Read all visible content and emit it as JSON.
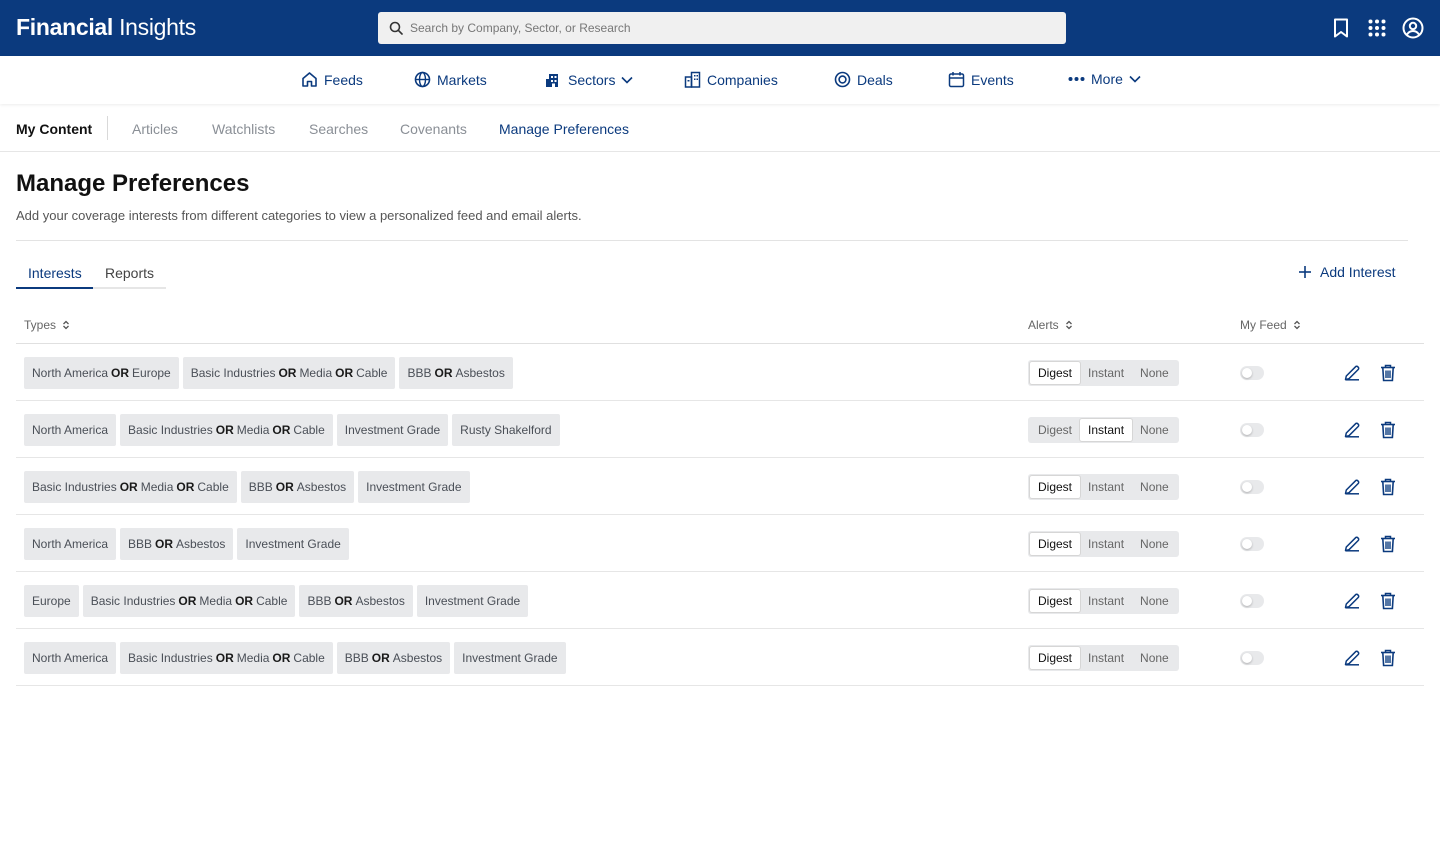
{
  "app": {
    "brand_bold": "Financial",
    "brand_light": " Insights",
    "search_placeholder": "Search by Company, Sector, or Research",
    "icons": [
      "bookmark-icon",
      "apps-grid-icon",
      "user-circle-icon"
    ]
  },
  "colors": {
    "brand": "#0b3a7e",
    "tag_bg": "#e8e9eb",
    "divider": "#e6e6e6"
  },
  "mainnav": [
    {
      "label": "Feeds",
      "icon": "home-icon"
    },
    {
      "label": "Markets",
      "icon": "globe-icon"
    },
    {
      "label": "Sectors",
      "icon": "building-icon",
      "dropdown": true
    },
    {
      "label": "Companies",
      "icon": "office-icon"
    },
    {
      "label": "Deals",
      "icon": "target-icon"
    },
    {
      "label": "Events",
      "icon": "calendar-icon"
    },
    {
      "label": "More",
      "icon": "dots-icon",
      "dropdown": true
    }
  ],
  "subnav": {
    "title": "My Content",
    "items": [
      "Articles",
      "Watchlists",
      "Searches",
      "Covenants",
      "Manage Preferences"
    ],
    "active": "Manage Preferences"
  },
  "page": {
    "title": "Manage Preferences",
    "description": "Add your coverage interests from different categories to view a personalized feed and email alerts."
  },
  "tabs": {
    "items": [
      "Interests",
      "Reports"
    ],
    "active": "Interests"
  },
  "add_interest_label": "Add Interest",
  "table": {
    "headers": {
      "types": "Types",
      "alerts": "Alerts",
      "feed": "My Feed"
    },
    "alert_options": [
      "Digest",
      "Instant",
      "None"
    ],
    "or_word": "OR",
    "rows": [
      {
        "tags": [
          [
            "North America",
            "Europe"
          ],
          [
            "Basic Industries",
            "Media",
            "Cable"
          ],
          [
            "BBB",
            "Asbestos"
          ]
        ],
        "alert": "Digest",
        "feed": false
      },
      {
        "tags": [
          [
            "North America"
          ],
          [
            "Basic Industries",
            "Media",
            "Cable"
          ],
          [
            "Investment Grade"
          ],
          [
            "Rusty Shakelford"
          ]
        ],
        "alert": "Instant",
        "feed": false
      },
      {
        "tags": [
          [
            "Basic Industries",
            "Media",
            "Cable"
          ],
          [
            "BBB",
            "Asbestos"
          ],
          [
            "Investment Grade"
          ]
        ],
        "alert": "Digest",
        "feed": false
      },
      {
        "tags": [
          [
            "North America"
          ],
          [
            "BBB",
            "Asbestos"
          ],
          [
            "Investment Grade"
          ]
        ],
        "alert": "Digest",
        "feed": false
      },
      {
        "tags": [
          [
            "Europe"
          ],
          [
            "Basic Industries",
            "Media",
            "Cable"
          ],
          [
            "BBB",
            "Asbestos"
          ],
          [
            "Investment Grade"
          ]
        ],
        "alert": "Digest",
        "feed": false
      },
      {
        "tags": [
          [
            "North America"
          ],
          [
            "Basic Industries",
            "Media",
            "Cable"
          ],
          [
            "BBB",
            "Asbestos"
          ],
          [
            "Investment Grade"
          ]
        ],
        "alert": "Digest",
        "feed": false
      }
    ]
  }
}
